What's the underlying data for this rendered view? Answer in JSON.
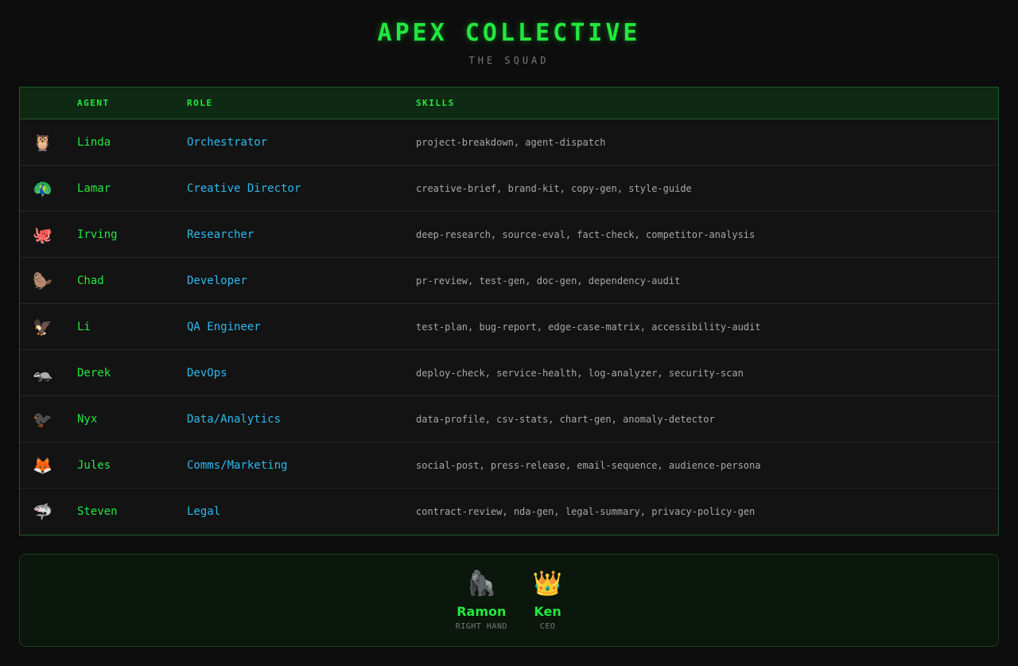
{
  "header": {
    "title": "APEX COLLECTIVE",
    "subtitle": "THE SQUAD"
  },
  "table": {
    "columns": {
      "agent": "AGENT",
      "role": "ROLE",
      "skills": "SKILLS"
    },
    "rows": [
      {
        "icon": "owl-icon",
        "emoji": "🦉",
        "agent": "Linda",
        "role": "Orchestrator",
        "skills": "project-breakdown, agent-dispatch"
      },
      {
        "icon": "peacock-icon",
        "emoji": "🦚",
        "agent": "Lamar",
        "role": "Creative Director",
        "skills": "creative-brief, brand-kit, copy-gen, style-guide"
      },
      {
        "icon": "octopus-icon",
        "emoji": "🐙",
        "agent": "Irving",
        "role": "Researcher",
        "skills": "deep-research, source-eval, fact-check, competitor-analysis"
      },
      {
        "icon": "beaver-icon",
        "emoji": "🦫",
        "agent": "Chad",
        "role": "Developer",
        "skills": "pr-review, test-gen, doc-gen, dependency-audit"
      },
      {
        "icon": "eagle-icon",
        "emoji": "🦅",
        "agent": "Li",
        "role": "QA Engineer",
        "skills": "test-plan, bug-report, edge-case-matrix, accessibility-audit"
      },
      {
        "icon": "badger-icon",
        "emoji": "🦡",
        "agent": "Derek",
        "role": "DevOps",
        "skills": "deploy-check, service-health, log-analyzer, security-scan"
      },
      {
        "icon": "crow-icon",
        "emoji": "🐦‍⬛",
        "agent": "Nyx",
        "role": "Data/Analytics",
        "skills": "data-profile, csv-stats, chart-gen, anomaly-detector"
      },
      {
        "icon": "fox-icon",
        "emoji": "🦊",
        "agent": "Jules",
        "role": "Comms/Marketing",
        "skills": "social-post, press-release, email-sequence, audience-persona"
      },
      {
        "icon": "shark-icon",
        "emoji": "🦈",
        "agent": "Steven",
        "role": "Legal",
        "skills": "contract-review, nda-gen, legal-summary, privacy-policy-gen"
      }
    ]
  },
  "leaders": [
    {
      "icon": "gorilla-icon",
      "emoji": "🦍",
      "name": "Ramon",
      "title": "RIGHT HAND"
    },
    {
      "icon": "crown-icon",
      "emoji": "👑",
      "name": "Ken",
      "title": "CEO"
    }
  ],
  "colors": {
    "background": "#0d0d0d",
    "accent_green": "#22e83e",
    "role_blue": "#2eb8ef",
    "skills_gray": "#a8a8a8",
    "border_green": "#1d5a27"
  }
}
